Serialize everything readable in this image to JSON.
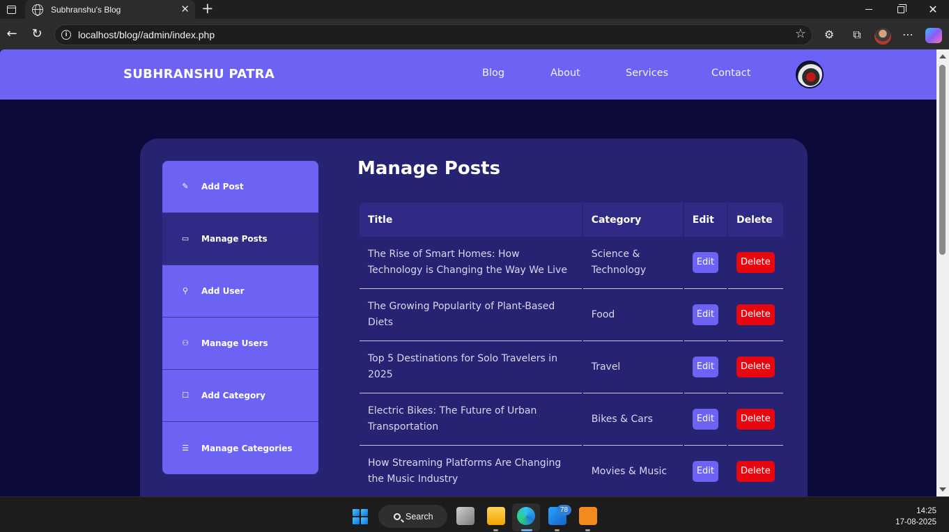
{
  "browser": {
    "tab_title": "Subhranshu's Blog",
    "tab_close": "✕",
    "new_tab": "+",
    "url": "localhost/blog//admin/index.php"
  },
  "site": {
    "brand": "SUBHRANSHU PATRA",
    "nav": [
      "Blog",
      "About",
      "Services",
      "Contact"
    ]
  },
  "sidebar": {
    "items": [
      {
        "label": "Add Post",
        "icon": "pencil-icon",
        "active": false
      },
      {
        "label": "Manage Posts",
        "icon": "id-card-icon",
        "active": true
      },
      {
        "label": "Add User",
        "icon": "user-plus-icon",
        "active": false
      },
      {
        "label": "Manage Users",
        "icon": "users-icon",
        "active": false
      },
      {
        "label": "Add Category",
        "icon": "edit-box-icon",
        "active": false
      },
      {
        "label": "Manage Categories",
        "icon": "list-icon",
        "active": false
      }
    ]
  },
  "main": {
    "title": "Manage Posts",
    "columns": [
      "Title",
      "Category",
      "Edit",
      "Delete"
    ],
    "edit_label": "Edit",
    "delete_label": "Delete",
    "rows": [
      {
        "title": "The Rise of Smart Homes: How Technology is Changing the Way We Live",
        "category": "Science & Technology"
      },
      {
        "title": "The Growing Popularity of Plant-Based Diets",
        "category": "Food"
      },
      {
        "title": "Top 5 Destinations for Solo Travelers in 2025",
        "category": "Travel"
      },
      {
        "title": "Electric Bikes: The Future of Urban Transportation",
        "category": "Bikes & Cars"
      },
      {
        "title": "How Streaming Platforms Are Changing the Music Industry",
        "category": "Movies & Music"
      }
    ]
  },
  "taskbar": {
    "search_label": "Search",
    "badge_count": "78",
    "time": "14:25",
    "date": "17-08-2025"
  },
  "colors": {
    "header": "#6c63f5",
    "page_bg": "#0b0a3a",
    "panel": "#262372",
    "active_item": "#2f2b85",
    "delete": "#e8070e"
  }
}
